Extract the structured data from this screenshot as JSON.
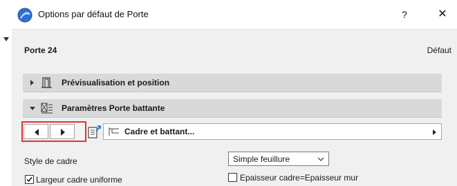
{
  "window": {
    "title": "Options par défaut de Porte",
    "help_label": "?",
    "close_label": "✕"
  },
  "header": {
    "object_name": "Porte 24",
    "default_label": "Défaut"
  },
  "panels": [
    {
      "label": "Prévisualisation et position",
      "expanded": false,
      "icon": "preview-position-icon"
    },
    {
      "label": "Paramètres Porte battante",
      "expanded": true,
      "icon": "door-parameters-icon"
    }
  ],
  "page_nav": {
    "prev_icon": "triangle-left-icon",
    "next_icon": "triangle-right-icon",
    "export_icon": "export-settings-icon",
    "current_page": "Cadre et battant...",
    "highlight_color": "#e23030"
  },
  "fields": {
    "frame_style_label": "Style de cadre",
    "frame_style_value": "Simple feuillure",
    "uniform_width_label": "Largeur cadre uniforme",
    "uniform_width_checked": true,
    "frame_thickness_label": "Epaisseur cadre=Epaisseur mur",
    "frame_thickness_checked": false
  }
}
